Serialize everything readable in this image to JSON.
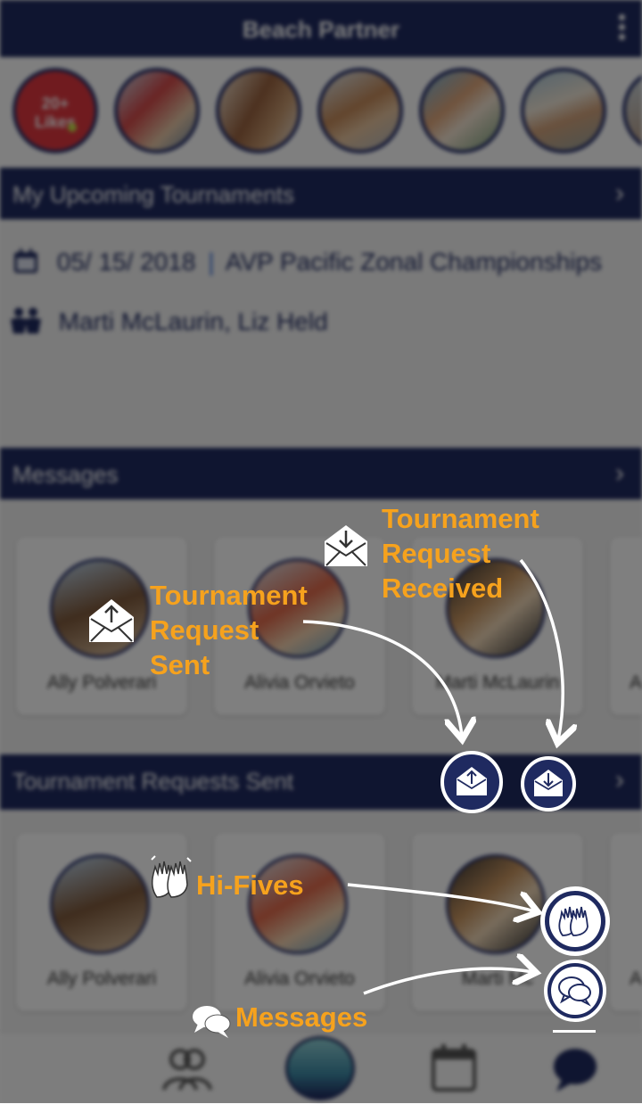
{
  "app": {
    "title": "Beach Partner"
  },
  "stories": {
    "likes_badge": "20+\nLikes",
    "likes_line1": "20+",
    "likes_line2": "Likes",
    "photo_count": 6
  },
  "upcoming": {
    "header": "My Upcoming Tournaments",
    "date": "05/ 15/ 2018",
    "separator": "|",
    "event": "AVP Pacific Zonal Championships",
    "partners": "Marti McLaurin, Liz Held"
  },
  "messages": {
    "header": "Messages",
    "cards": [
      "Ally Polverari",
      "Alivia Orvieto",
      "Marti McLaurin",
      "A"
    ]
  },
  "requests_sent": {
    "header": "Tournament Requests Sent",
    "cards": [
      "Ally Polverari",
      "Alivia Orvieto",
      "Marti Mc",
      "A"
    ]
  },
  "nav": {
    "items": [
      "partners-icon",
      "home-logo",
      "calendar-icon",
      "chat-icon"
    ],
    "active": "chat-icon"
  },
  "overlay": {
    "request_received_line1": "Tournament",
    "request_received_line2": "Request",
    "request_received_line3": "Received",
    "request_sent_line1": "Tournament",
    "request_sent_line2": "Request",
    "request_sent_line3": "Sent",
    "hifives_label": "Hi-Fives",
    "messages_label": "Messages",
    "accent_color": "#f6a21d",
    "brand_color": "#1f2a60"
  }
}
